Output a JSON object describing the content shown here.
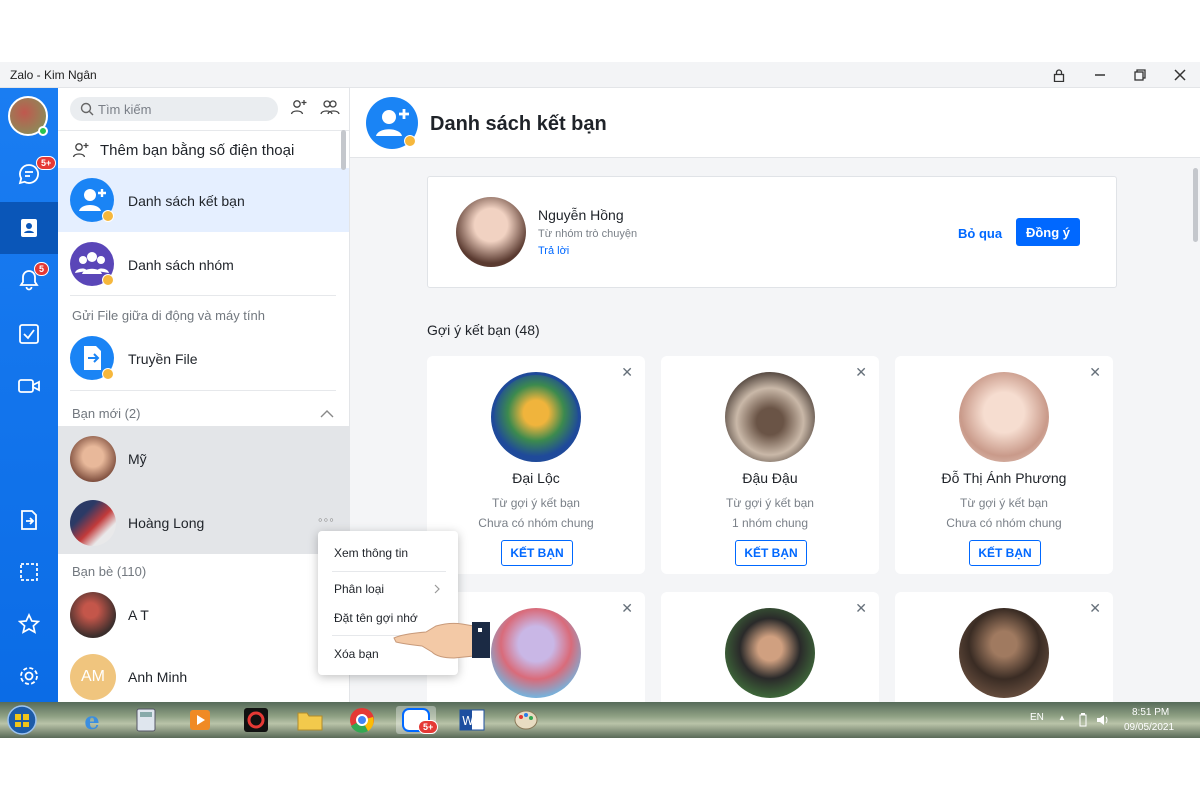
{
  "window": {
    "title": "Zalo - Kim Ngân"
  },
  "nav": {
    "chat_badge": "5+",
    "notify_badge": "5"
  },
  "left": {
    "search_placeholder": "Tìm kiếm",
    "add_by_phone": "Thêm bạn bằng số điện thoại",
    "friend_list": "Danh sách kết bạn",
    "group_list": "Danh sách nhóm",
    "send_file_section": "Gửi File giữa di động và máy tính",
    "transfer_file": "Truyền File",
    "new_friends_section": "Bạn mới (2)",
    "new_friends": [
      {
        "name": "Mỹ"
      },
      {
        "name": "Hoàng Long"
      }
    ],
    "friends_section": "Bạn bè (110)",
    "friends": [
      {
        "name": "A T"
      },
      {
        "name": "Anh Minh",
        "initials": "AM"
      }
    ]
  },
  "context_menu": {
    "items": [
      "Xem thông tin",
      "Phân loại",
      "Đặt tên gợi nhớ",
      "Xóa bạn"
    ]
  },
  "main": {
    "title": "Danh sách kết bạn",
    "request": {
      "name": "Nguyễn Hồng",
      "source": "Từ nhóm trò chuyện",
      "reply": "Trả lời",
      "skip": "Bỏ qua",
      "accept": "Đồng ý"
    },
    "suggest_title": "Gợi ý kết bạn (48)",
    "suggestions": [
      {
        "name": "Đại Lộc",
        "source": "Từ gợi ý kết bạn",
        "groups": "Chưa có nhóm chung",
        "button": "KẾT BẠN"
      },
      {
        "name": "Đậu Đậu",
        "source": "Từ gợi ý kết bạn",
        "groups": "1 nhóm chung",
        "button": "KẾT BẠN"
      },
      {
        "name": "Đỗ Thị Ánh Phương",
        "source": "Từ gợi ý kết bạn",
        "groups": "Chưa có nhóm chung",
        "button": "KẾT BẠN"
      }
    ]
  },
  "taskbar": {
    "lang": "EN",
    "time": "8:51 PM",
    "date": "09/05/2021",
    "zalo_badge": "5+"
  }
}
